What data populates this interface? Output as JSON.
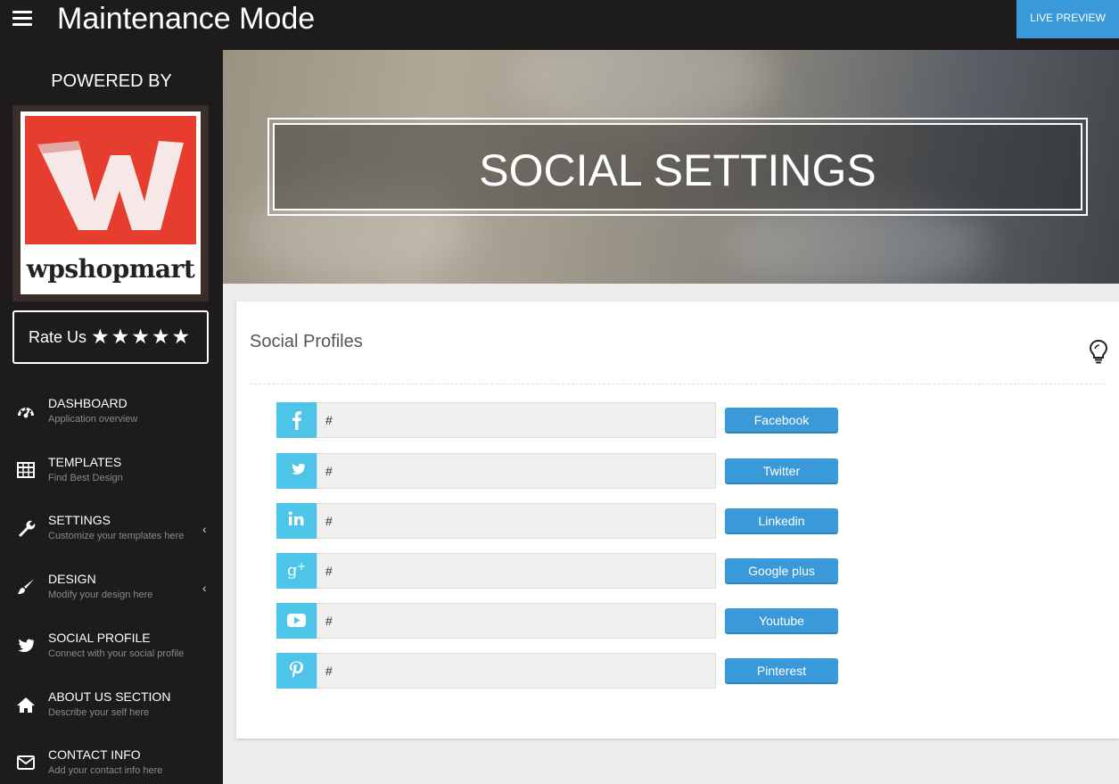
{
  "header": {
    "title": "Maintenance Mode",
    "live_preview": "LIVE PREVIEW"
  },
  "sidebar": {
    "powered_by": "POWERED BY",
    "logo_text": "wpshopmart",
    "logo_letter": "W",
    "rate_label": "Rate Us",
    "rate_stars": "★★★★★",
    "items": [
      {
        "title": "DASHBOARD",
        "subtitle": "Application overview",
        "icon": "dashboard-icon"
      },
      {
        "title": "TEMPLATES",
        "subtitle": "Find Best Design",
        "icon": "table-icon"
      },
      {
        "title": "SETTINGS",
        "subtitle": "Customize your templates here",
        "icon": "wrench-icon"
      },
      {
        "title": "DESIGN",
        "subtitle": "Modify your design here",
        "icon": "brush-icon"
      },
      {
        "title": "SOCIAL PROFILE",
        "subtitle": "Connect with your social profile",
        "icon": "twitter-icon"
      },
      {
        "title": "ABOUT US SECTION",
        "subtitle": "Describe your self here",
        "icon": "home-icon"
      },
      {
        "title": "CONTACT INFO",
        "subtitle": "Add your contact info here",
        "icon": "envelope-icon"
      }
    ],
    "chevron": "‹"
  },
  "hero": {
    "title": "SOCIAL SETTINGS"
  },
  "panel": {
    "title": "Social Profiles",
    "help_icon": "lightbulb-icon",
    "profiles": [
      {
        "network": "Facebook",
        "value": "#",
        "icon": "facebook-icon"
      },
      {
        "network": "Twitter",
        "value": "#",
        "icon": "twitter-icon"
      },
      {
        "network": "Linkedin",
        "value": "#",
        "icon": "linkedin-icon"
      },
      {
        "network": "Google plus",
        "value": "#",
        "icon": "google-plus-icon"
      },
      {
        "network": "Youtube",
        "value": "#",
        "icon": "youtube-icon"
      },
      {
        "network": "Pinterest",
        "value": "#",
        "icon": "pinterest-icon"
      }
    ]
  },
  "colors": {
    "dark": "#1d1b1c",
    "accent": "#3a9ad9",
    "social_icon_bg": "#4dc4e8",
    "logo_red": "#e63d2f"
  }
}
